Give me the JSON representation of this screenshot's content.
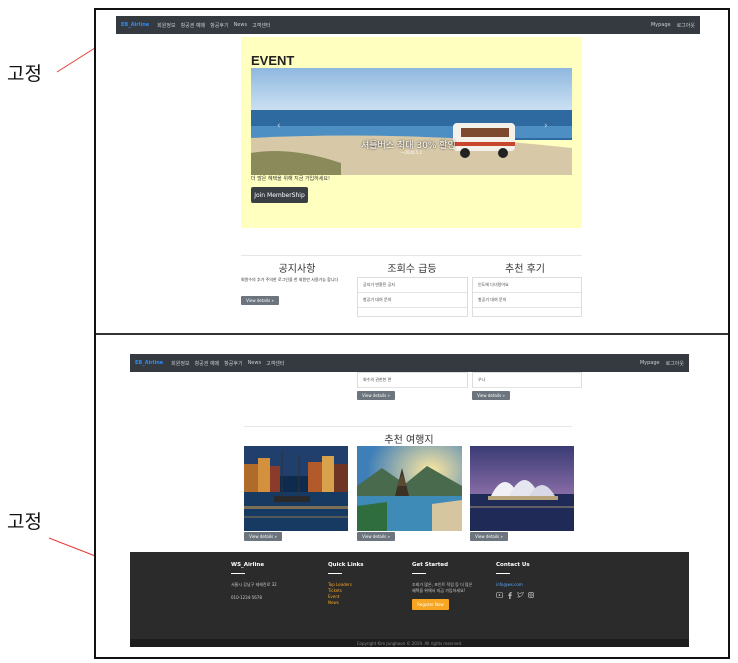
{
  "annotations": {
    "top_label": "고정",
    "bottom_label": "고정"
  },
  "nav": {
    "brand": "EB_Airline",
    "links": [
      "회원정보",
      "항공권 예매",
      "항공후기",
      "News",
      "고객센터"
    ],
    "right": [
      "Mypage",
      "로그아웃"
    ]
  },
  "event": {
    "title": "EVENT",
    "slide_caption": "셔틀버스 최대 30% 할인",
    "slide_sub": "~2020.5.1",
    "promo_text": "더 많은 혜택을 위해 지금 가입하세요!",
    "join_label": "Join MemberShip"
  },
  "columns": {
    "notice": {
      "title": "공지사항",
      "body": "회원수의 추가 주의한 로그인을 한 회원만 사용가능 합니다",
      "btn": "View details »"
    },
    "popular": {
      "title": "조회수 급등",
      "items": [
        "공지가 변환된 공지",
        "항공기 대여 문의"
      ],
      "more_item": "회수의 권한한 면",
      "btn": "View details »"
    },
    "review": {
      "title": "추천 후기",
      "items": [
        "인도에 다녀왔어요",
        "항공기 대여 문의"
      ],
      "more_item": "우나",
      "btn": "View details »"
    }
  },
  "recommend": {
    "title": "추천 여행지",
    "cards": [
      {
        "btn": "View details »"
      },
      {
        "btn": "View details »"
      },
      {
        "btn": "View details »"
      }
    ]
  },
  "footer": {
    "col1": {
      "title": "WS_Airline",
      "addr": "서울시 강남구 테헤란로 32",
      "phone": "010-1234-5678"
    },
    "col2": {
      "title": "Quick Links",
      "links": [
        "Top Leaders",
        "Tickets",
        "Event",
        "News"
      ]
    },
    "col3": {
      "title": "Get Started",
      "text1": "조회가 많은, 포인트 적립 등 더 많은",
      "text2": "혜택을 위해서 지금 가입하세요!",
      "btn": "Register Now"
    },
    "col4": {
      "title": "Contact Us",
      "email": "info@ws.com"
    },
    "copyright": "Copyright Kim Junghoon © 2019. All rights reserved."
  },
  "colors": {
    "nav": "#343a40",
    "brand": "#2f8cf7",
    "event_bg": "#ffffc0",
    "footer": "#2b2b2b",
    "accent": "#f6a623"
  }
}
